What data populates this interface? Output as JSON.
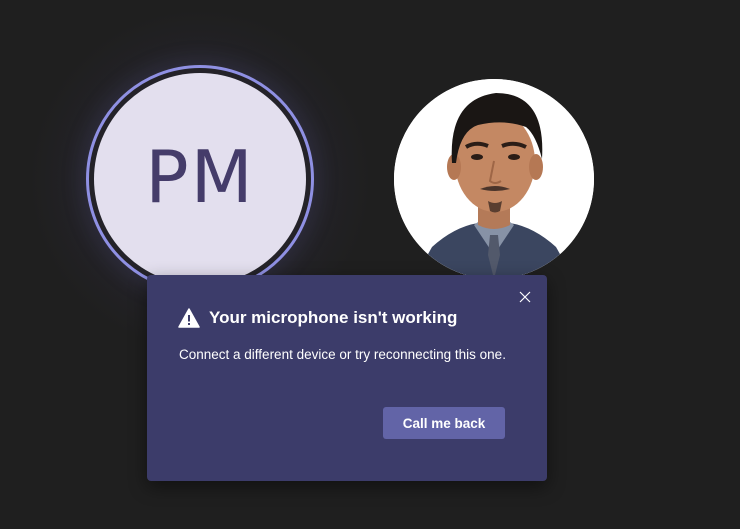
{
  "participants": [
    {
      "initials": "PM",
      "speaking": true,
      "ring_color": "#8f90e3",
      "avatar_bg": "#e3dfee",
      "initials_color": "#453c6a"
    },
    {
      "type": "photo"
    }
  ],
  "notification": {
    "icon": "warning-icon",
    "title": "Your microphone isn't working",
    "message": "Connect a different device or try reconnecting this one.",
    "action_label": "Call me back",
    "close_icon": "close-icon",
    "background": "#3c3c6a",
    "button_color": "#6264a7"
  }
}
